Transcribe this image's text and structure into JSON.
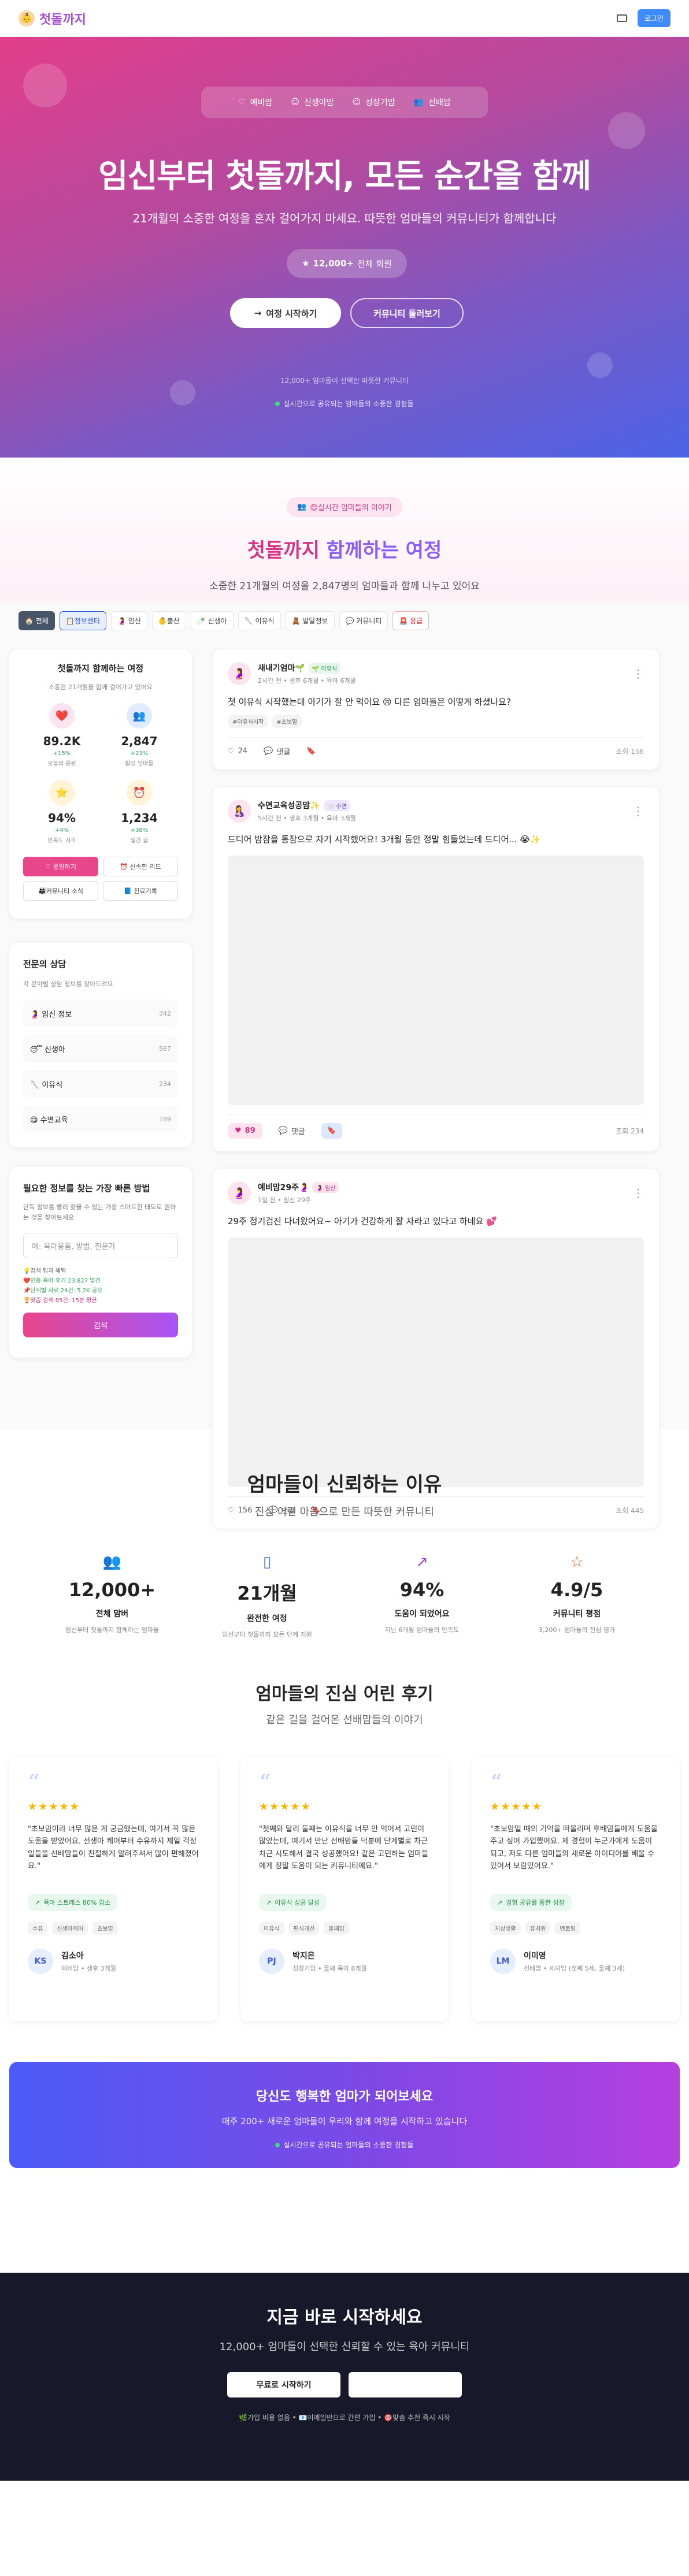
{
  "nav": {
    "logo_icon": "baby-emoji",
    "title": "첫돌까지",
    "login": "로그인"
  },
  "hero": {
    "tabs": [
      {
        "icon": "heart-icon",
        "label": "예비맘"
      },
      {
        "icon": "smile-icon",
        "label": "신생아맘"
      },
      {
        "icon": "smile-icon",
        "label": "성장기맘"
      },
      {
        "icon": "users-icon",
        "label": "선배맘"
      }
    ],
    "title": "임신부터 첫돌까지, 모든 순간을 함께",
    "subtitle": "21개월의 소중한 여정을 혼자 걸어가지 마세요. 따뜻한 엄마들의 커뮤니티가 함께합니다",
    "members_count": "12,000+",
    "members_label": "전체 회원",
    "start_btn": "여정 시작하기",
    "community_btn": "커뮤니티 둘러보기",
    "small1": "12,000+ 엄마들이 선택한 따뜻한 커뮤니티",
    "small2": "실시간으로 공유되는 엄마들의 소중한 경험들"
  },
  "journey": {
    "badge": "😊실시간 엄마들의 이야기",
    "title_a": "첫돌까지 ",
    "title_b": "함께하는 여정",
    "subtitle": "소중한 21개월의 여정을 2,847명의 엄마들과 함께 나누고 있어요"
  },
  "filters": [
    "🏠 전체",
    "📋정보센터",
    "🤰 임신",
    "👶출산",
    "🍼 신생아",
    "🥄 이유식",
    "🧸 발달정보",
    "💬 커뮤니티",
    "🚨 응급"
  ],
  "sidebar": {
    "title": "첫돌까지 함께하는 여정",
    "subtitle": "소중한 21개월을 함께 걸어가고 있어요",
    "stats": [
      {
        "icon": "❤️",
        "value": "89.2K",
        "change": "+15%",
        "label": "오늘의 응원"
      },
      {
        "icon": "👥",
        "value": "2,847",
        "change": "+23%",
        "label": "활성 엄마들"
      },
      {
        "icon": "⭐",
        "value": "94%",
        "change": "+4%",
        "label": "만족도 지수"
      },
      {
        "icon": "⏰",
        "value": "1,234",
        "change": "+38%",
        "label": "일간 글"
      }
    ],
    "btns": [
      "♡ 응원하기",
      "⏰ 신속한 리드",
      "👨‍👩‍👧커뮤니티 소식",
      "📘 진료기록"
    ],
    "consult_title": "전문의 상담",
    "consult_sub": "각 분야별 상담 정보를 찾아드려요",
    "experts": [
      {
        "label": "🤰 임신 정보",
        "count": "342"
      },
      {
        "label": "😴 신생아",
        "count": "567"
      },
      {
        "label": "🥄 이유식",
        "count": "234"
      },
      {
        "label": "😋 수면교육",
        "count": "189"
      }
    ],
    "search_title": "필요한 정보를 찾는 가장 빠른 방법",
    "search_sub": "단독 정보를 빨리 찾을 수 있는 가장 스마트한 태도로 원하는 것을 찾아보세요",
    "search_placeholder": "예: 육아용품, 방법, 전문가",
    "tips_title": "💡검색 팁과 혜택",
    "tip1": "❤️인증 육아 후기 23,827 발견",
    "tip2": "📌단계별 자료 24건: 5.2K 공유",
    "tip3": "🏆맞춤 검색 85건: 15분 평균",
    "search_btn": "검색"
  },
  "posts": [
    {
      "avatar": "🤰",
      "name": "새내기엄마🌱",
      "tag": "🌱 이유식",
      "meta": "2시간 전  •  생후 6개월  •  육아 6개월",
      "text": "첫 이유식 시작했는데 아기가 잘 안 먹어요 😢 다른 엄마들은 어떻게 하셨나요?",
      "tags": [
        "#이유식시작",
        "#초보맘"
      ],
      "likes": "24",
      "comments": "댓글",
      "views": "조회 156",
      "image": false,
      "liked": false,
      "saved": false
    },
    {
      "avatar": "🤱",
      "name": "수면교육성공맘✨",
      "tag": "🤍 수면",
      "meta": "5시간 전  •  생후 3개월  •  육아 3개월",
      "text": "드디어 밤잠을 통잠으로 자기 시작했어요! 3개월 동안 정말 힘들었는데 드디어... 😭✨",
      "tags": [],
      "likes": "89",
      "comments": "댓글",
      "views": "조회 234",
      "image": true,
      "liked": true,
      "saved": true
    },
    {
      "avatar": "🤰",
      "name": "예비맘29주🤰",
      "tag": "🤰 임산",
      "meta": "1일 전  •  임신 29주",
      "text": "29주 정기검진 다녀왔어요~ 아기가 건강하게 잘 자라고 있다고 하네요 💕",
      "tags": [],
      "likes": "156",
      "comments": "댓글",
      "views": "조회 445",
      "image": true,
      "liked": false,
      "saved": false
    }
  ],
  "why": {
    "title": "엄마들이 신뢰하는 이유",
    "subtitle": "진심 어린 마음으로 만든 따뜻한 커뮤니티",
    "stats": [
      {
        "icon": "users-icon",
        "color": "#e8468b",
        "value": "12,000+",
        "label": "전체 맘버",
        "desc": "임신부터 첫돌까지 함께하는 엄마들"
      },
      {
        "icon": "book-icon",
        "color": "#3d6cf3",
        "value": "21개월",
        "label": "완전한 여정",
        "desc": "임신부터 첫돌까지 모든 단계 지원"
      },
      {
        "icon": "trend-icon",
        "color": "#9b3fdd",
        "value": "94%",
        "label": "도움이 되었어요",
        "desc": "지난 6개월 엄마들의 만족도"
      },
      {
        "icon": "star-icon",
        "color": "#f05a28",
        "value": "4.9/5",
        "label": "커뮤니티 평점",
        "desc": "3,200+ 엄마들의 진심 평가"
      }
    ]
  },
  "reviews": {
    "title": "엄마들의 진심 어린 후기",
    "subtitle": "같은 길을 걸어온 선배맘들의 이야기",
    "items": [
      {
        "text": "\"초보맘이라 너무 많은 게 궁금했는데, 여기서 꼭 많은 도움을 받았어요. 선생아 케어부터 수유까지 제일 걱정 일들을 선배맘들이 친절하게 알려주셔서 많이 편해졌어요.\"",
        "badge": "육아 스트레스 80% 감소",
        "tags": [
          "수유",
          "신생아케어",
          "초보맘"
        ],
        "initials": "KS",
        "name": "김소아",
        "detail": "예비맘  •  생후 3개월"
      },
      {
        "text": "\"첫째와 달리 둘째는 이유식을 너무 안 먹어서 고민이 많았는데, 여기서 만난 선배맘들 덕분에 단계별로 차근차근 시도해서 결국 성공했어요! 같은 고민하는 엄마들에게 정말 도움이 되는 커뮤니티예요.\"",
        "badge": "이유식 성공 달성",
        "tags": [
          "이유식",
          "편식개선",
          "둘째맘"
        ],
        "initials": "PJ",
        "name": "박지은",
        "detail": "성장기맘  •  둘째 육아 8개월"
      },
      {
        "text": "\"초보맘일 때의 기억을 떠올리며 후배맘들에게 도움을 주고 싶어 가입했어요. 제 경험이 누군가에게 도움이 되고, 저도 다른 엄마들의 새로운 아이디어를 배울 수 있어서 보람있어요.\"",
        "badge": "경험 공유를 통한 성장",
        "tags": [
          "지상생활",
          "유치원",
          "멘토링"
        ],
        "initials": "LM",
        "name": "이미영",
        "detail": "선배맘  •  세자맘 (첫째 5세, 둘째 3세)"
      }
    ]
  },
  "cta": {
    "title": "당신도 행복한 엄마가 되어보세요",
    "subtitle": "매주 200+ 새로운 엄마들이 우리와 함께 여정을 시작하고 있습니다",
    "note": "실시간으로 공유되는 엄마들의 소중한 경험들"
  },
  "footer": {
    "title": "지금 바로 시작하세요",
    "subtitle": "12,000+ 엄마들이 선택한 신뢰할 수 있는 육아 커뮤니티",
    "btn1": "무료로 시작하기",
    "btn2": "",
    "note": "🌿가입 비용 없음 • 📧이메일만으로 간편 가입 • 🎯맞춤 추천 즉시 시작"
  }
}
